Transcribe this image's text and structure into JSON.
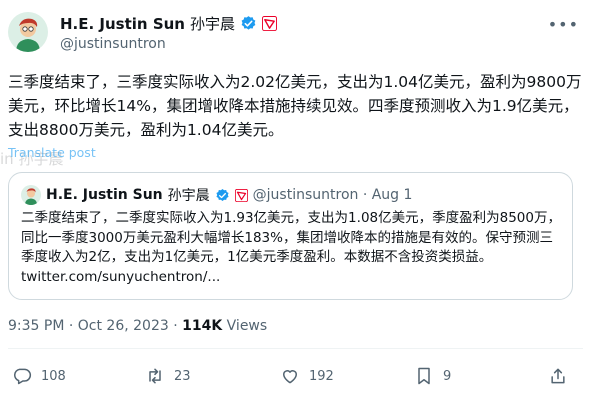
{
  "author": {
    "name": "H.E. Justin Sun",
    "name_cn": "孙宇晨",
    "handle": "@justinsuntron"
  },
  "tweet": {
    "text": "三季度结束了，三季度实际收入为2.02亿美元，支出为1.04亿美元，盈利为9800万美元，环比增长14%，集团增收降本措施持续见效。四季度预测收入为1.9亿美元，支出8800万美元，盈利为1.04亿美元。",
    "translate_label": "Translate post",
    "overlay_fragment": "in 孙宇晨",
    "time": "9:35 PM · Oct 26, 2023 · ",
    "views_count": "114K",
    "views_label": " Views"
  },
  "quote": {
    "name": "H.E. Justin Sun",
    "name_cn": "孙宇晨",
    "meta": "@justinsuntron · Aug 1",
    "text": "二季度结束了，二季度实际收入为1.93亿美元，支出为1.08亿美元，季度盈利为8500万，同比一季度3000万美元盈利大幅增长183%，集团增收降本的措施是有效的。保守预测三季度收入为2亿，支出为1亿美元，1亿美元季度盈利。本数据不含投资类损益。 twitter.com/sunyuchentron/..."
  },
  "actions": {
    "replies": "108",
    "reposts": "23",
    "likes": "192",
    "bookmarks": "9"
  },
  "icons": [
    "avatar",
    "verified-badge-icon",
    "tron-badge-icon",
    "more-icon",
    "reply-icon",
    "repost-icon",
    "like-icon",
    "bookmark-icon",
    "share-icon"
  ],
  "colors": {
    "verified": "#1d9bf0",
    "tron": "#eb0029",
    "muted": "#536471",
    "text": "#0f1419"
  }
}
